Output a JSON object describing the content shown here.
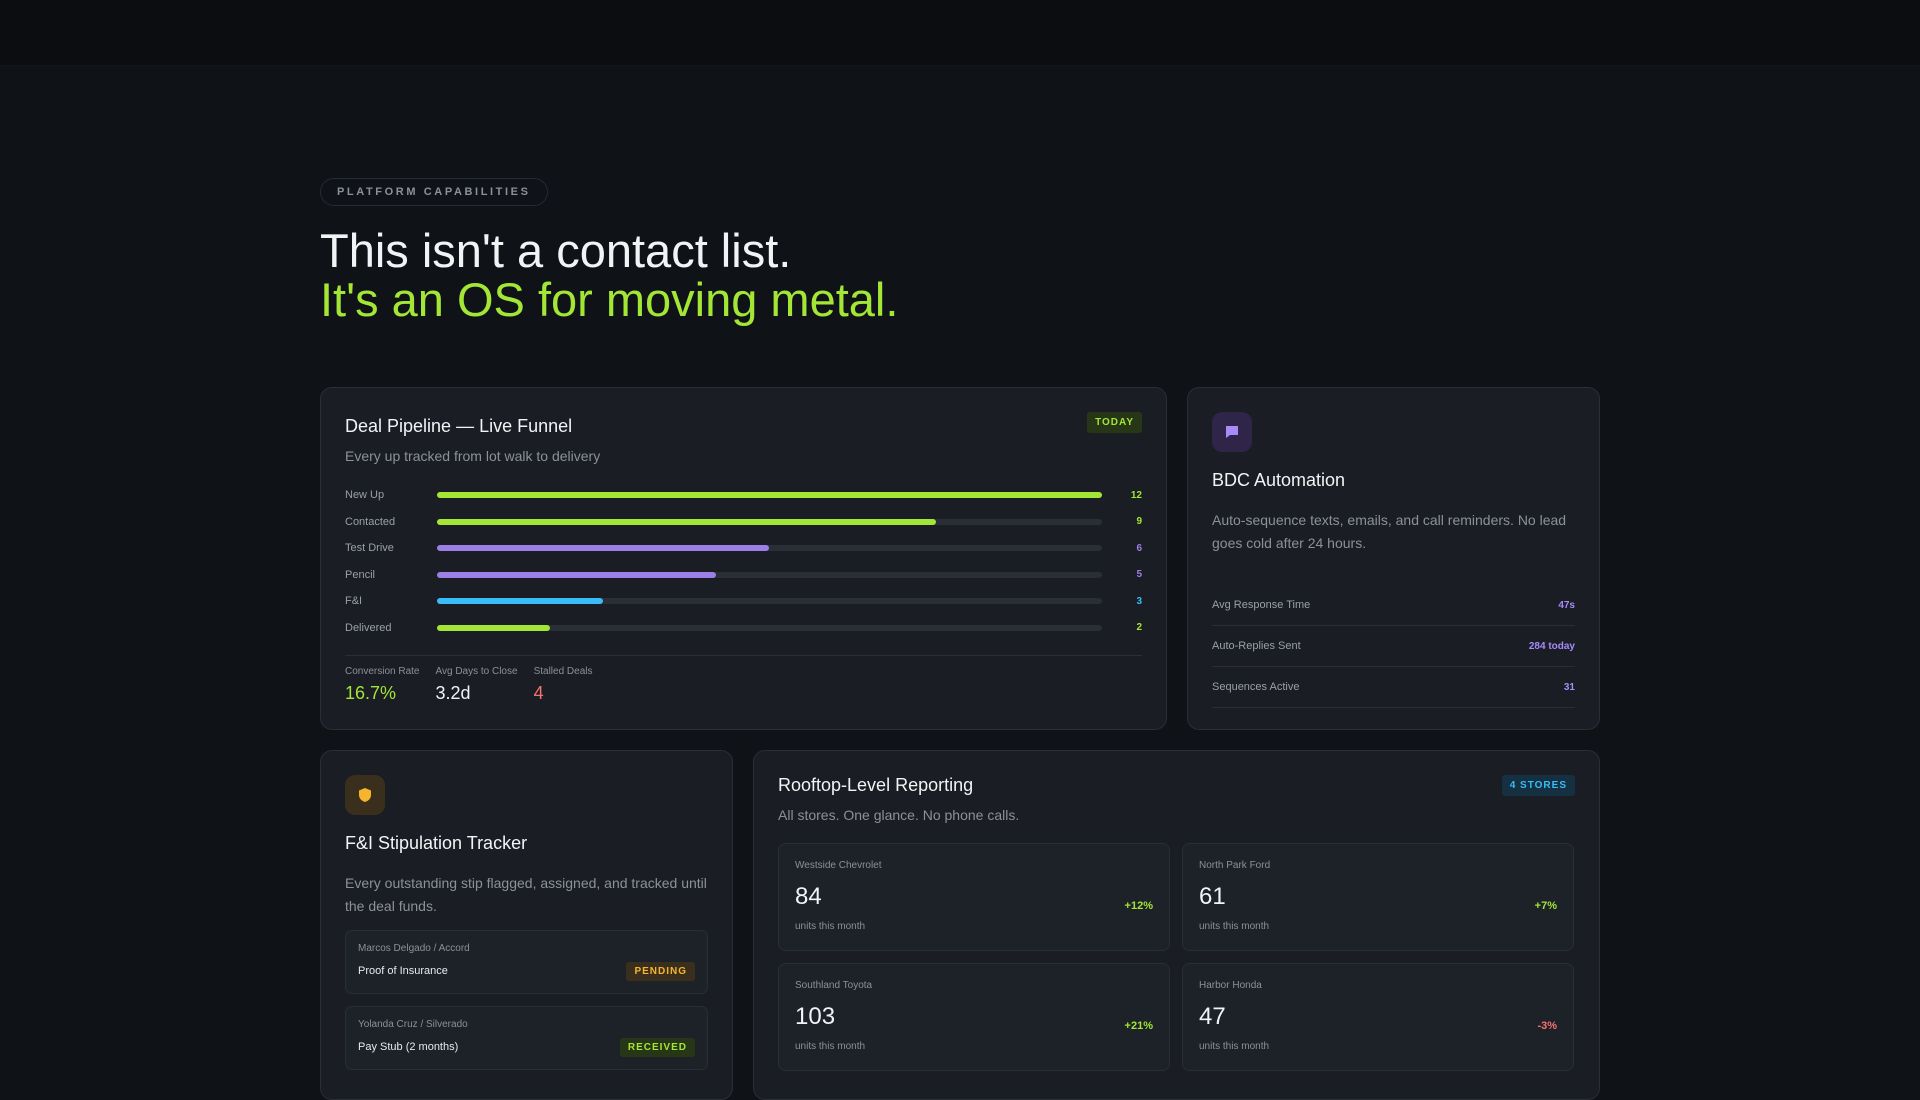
{
  "eyebrow": "PLATFORM CAPABILITIES",
  "headline": {
    "line1": "This isn't a contact list.",
    "line2": "It's an OS for moving metal."
  },
  "colors": {
    "accent_green": "#a3e635",
    "accent_purple": "#a78bfa",
    "accent_blue": "#38bdf8",
    "accent_amber": "#f59e0b",
    "accent_red": "#f87171"
  },
  "pipeline": {
    "title": "Deal Pipeline — Live Funnel",
    "subtitle": "Every up tracked from lot walk to delivery",
    "badge": "TODAY",
    "stages": [
      {
        "label": "New Up",
        "value": "12",
        "fraction": 1.0,
        "color": "#a3e635"
      },
      {
        "label": "Contacted",
        "value": "9",
        "fraction": 0.75,
        "color": "#a3e635"
      },
      {
        "label": "Test Drive",
        "value": "6",
        "fraction": 0.5,
        "color": "#9b7ee6"
      },
      {
        "label": "Pencil",
        "value": "5",
        "fraction": 0.42,
        "color": "#9b7ee6"
      },
      {
        "label": "F&I",
        "value": "3",
        "fraction": 0.25,
        "color": "#38bdf8"
      },
      {
        "label": "Delivered",
        "value": "2",
        "fraction": 0.17,
        "color": "#a3e635"
      }
    ],
    "stats": [
      {
        "label": "Conversion Rate",
        "value": "16.7%",
        "color": "#a3e635"
      },
      {
        "label": "Avg Days to Close",
        "value": "3.2d",
        "color": "#f1f3f5"
      },
      {
        "label": "Stalled Deals",
        "value": "4",
        "color": "#f87171"
      }
    ]
  },
  "bdc": {
    "icon": "chat-icon",
    "title": "BDC Automation",
    "description": "Auto-sequence texts, emails, and call reminders. No lead goes cold after 24 hours.",
    "metrics": [
      {
        "label": "Avg Response Time",
        "value": "47s"
      },
      {
        "label": "Auto-Replies Sent",
        "value": "284 today"
      },
      {
        "label": "Sequences Active",
        "value": "31"
      }
    ]
  },
  "fi": {
    "icon": "shield-icon",
    "title": "F&I Stipulation Tracker",
    "description": "Every outstanding stip flagged, assigned, and tracked until the deal funds.",
    "stips": [
      {
        "who": "Marcos Delgado / Accord",
        "doc": "Proof of Insurance",
        "status": "PENDING"
      },
      {
        "who": "Yolanda Cruz / Silverado",
        "doc": "Pay Stub (2 months)",
        "status": "RECEIVED"
      }
    ]
  },
  "rooftop": {
    "title": "Rooftop-Level Reporting",
    "subtitle": "All stores. One glance. No phone calls.",
    "badge": "4 STORES",
    "stores": [
      {
        "name": "Westside Chevrolet",
        "units": "84",
        "delta": "+12%",
        "foot": "units this month"
      },
      {
        "name": "North Park Ford",
        "units": "61",
        "delta": "+7%",
        "foot": "units this month"
      },
      {
        "name": "Southland Toyota",
        "units": "103",
        "delta": "+21%",
        "foot": "units this month"
      },
      {
        "name": "Harbor Honda",
        "units": "47",
        "delta": "-3%",
        "foot": "units this month"
      }
    ]
  }
}
